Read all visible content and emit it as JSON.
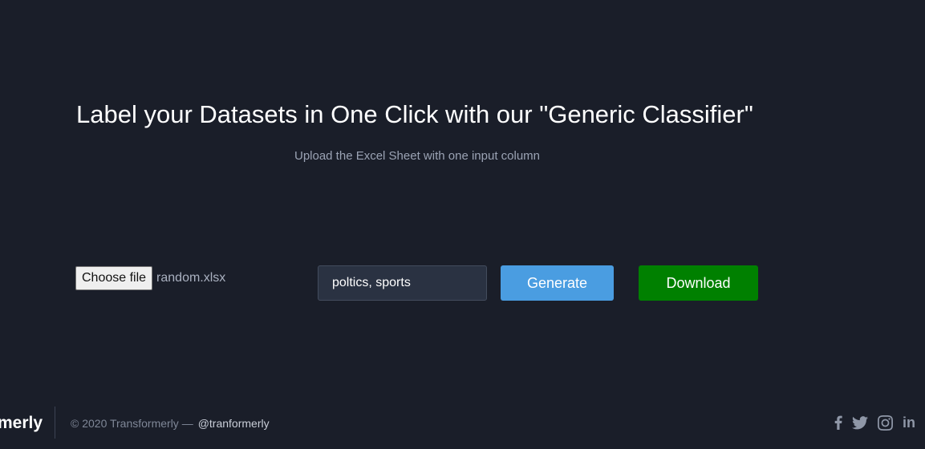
{
  "hero": {
    "title": "Label your Datasets in One Click with our \"Generic Classifier\"",
    "subtitle": "Upload the Excel Sheet with one input column"
  },
  "form": {
    "file_button_label": "Choose file",
    "file_name": "random.xlsx",
    "labels_value": "poltics, sports",
    "generate_label": "Generate",
    "download_label": "Download"
  },
  "footer": {
    "brand": "merly",
    "copyright": "© 2020 Transformerly —",
    "handle": "@tranformerly",
    "social_icons": [
      "facebook-icon",
      "twitter-icon",
      "instagram-icon",
      "linkedin-icon"
    ],
    "linkedin_glyph": "in"
  },
  "colors": {
    "background": "#1a1e29",
    "generate": "#4a9de1",
    "download": "#008000"
  }
}
